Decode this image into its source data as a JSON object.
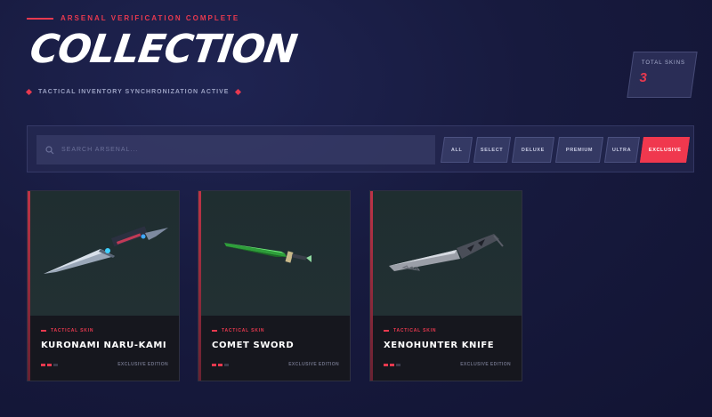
{
  "header": {
    "kicker": "Arsenal Verification Complete",
    "title": "COLLECTION",
    "sync_status": "Tactical Inventory Synchronization Active"
  },
  "stats": {
    "total_label": "Total Skins",
    "total_value": "3"
  },
  "search": {
    "placeholder": "SEARCH ARSENAL...",
    "value": ""
  },
  "filters": [
    {
      "label": "ALL",
      "active": false
    },
    {
      "label": "SELECT",
      "active": false
    },
    {
      "label": "DELUXE",
      "active": false
    },
    {
      "label": "PREMIUM",
      "active": false
    },
    {
      "label": "ULTRA",
      "active": false
    },
    {
      "label": "EXCLUSIVE",
      "active": true
    }
  ],
  "cards": [
    {
      "tag": "Tactical Skin",
      "name": "Kuronami Naru-Kami",
      "edition": "Exclusive Edition",
      "rarity": 2,
      "icon": "dagger-icon"
    },
    {
      "tag": "Tactical Skin",
      "name": "Comet Sword",
      "edition": "Exclusive Edition",
      "rarity": 2,
      "icon": "sword-icon"
    },
    {
      "tag": "Tactical Skin",
      "name": "Xenohunter Knife",
      "edition": "Exclusive Edition",
      "rarity": 2,
      "icon": "knife-icon"
    }
  ],
  "colors": {
    "accent": "#e8394f",
    "background": "#171a3e",
    "card": "#1c1d26"
  }
}
